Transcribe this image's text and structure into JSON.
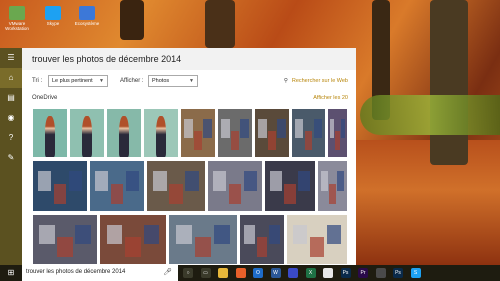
{
  "desktop": {
    "icons": [
      {
        "label": "VMware Workstation",
        "color": "#6aa84f"
      },
      {
        "label": "Skype",
        "color": "#1da1f2"
      },
      {
        "label": "Ecosystème",
        "color": "#3c78d8"
      }
    ]
  },
  "rail": {
    "items": [
      {
        "icon": "menu-icon",
        "glyph": "☰"
      },
      {
        "icon": "home-icon",
        "glyph": "⌂"
      },
      {
        "icon": "notebook-icon",
        "glyph": "▤"
      },
      {
        "icon": "location-icon",
        "glyph": "◉"
      },
      {
        "icon": "help-icon",
        "glyph": "?"
      },
      {
        "icon": "feedback-icon",
        "glyph": "✎"
      }
    ]
  },
  "panel": {
    "title": "trouver les photos de décembre 2014",
    "sort_label": "Tri :",
    "sort_value": "Le plus pertinent",
    "filter_label": "Afficher :",
    "filter_value": "Photos",
    "web_search": "Rechercher sur le Web",
    "source": "OneDrive",
    "show_all": "Afficher les 20"
  },
  "photos": [
    {
      "kind": "person",
      "bg": "#7db8a8"
    },
    {
      "kind": "person",
      "bg": "#8fc0b0"
    },
    {
      "kind": "person",
      "bg": "#86b9a9"
    },
    {
      "kind": "person",
      "bg": "#9cc7b8"
    },
    {
      "kind": "items",
      "bg": "#8b6b4a"
    },
    {
      "kind": "items",
      "bg": "#6b6b6b"
    },
    {
      "kind": "items",
      "bg": "#5a4a3a"
    },
    {
      "kind": "items",
      "bg": "#4a5a6a"
    },
    {
      "kind": "items",
      "bg": "#5c5070"
    },
    {
      "kind": "items",
      "bg": "#2e4a6a"
    },
    {
      "kind": "items",
      "bg": "#4a6a8a"
    },
    {
      "kind": "items",
      "bg": "#6a5a4a"
    },
    {
      "kind": "items",
      "bg": "#7a7a8a"
    },
    {
      "kind": "items",
      "bg": "#3a3a4a"
    },
    {
      "kind": "items",
      "bg": "#8a8a9a"
    },
    {
      "kind": "items",
      "bg": "#5a5a6a"
    },
    {
      "kind": "items",
      "bg": "#7a4a3a"
    },
    {
      "kind": "items",
      "bg": "#6a7a8a"
    },
    {
      "kind": "items",
      "bg": "#4a4a5a"
    },
    {
      "kind": "items",
      "bg": "#d8d0c0"
    },
    {
      "kind": "items",
      "bg": "#5a3a2a"
    }
  ],
  "taskbar": {
    "start_glyph": "⊞",
    "search_text": "trouver les photos de décembre 2014",
    "apps": [
      {
        "name": "cortana-icon",
        "color": "#3a3a2a",
        "glyph": "○"
      },
      {
        "name": "task-view-icon",
        "color": "#3a3a2a",
        "glyph": "▭"
      },
      {
        "name": "file-explorer-icon",
        "color": "#e8b83a",
        "glyph": ""
      },
      {
        "name": "firefox-icon",
        "color": "#e8602a",
        "glyph": ""
      },
      {
        "name": "outlook-icon",
        "color": "#1e6cc8",
        "glyph": "O"
      },
      {
        "name": "word-icon",
        "color": "#2b5797",
        "glyph": "W"
      },
      {
        "name": "firefox-2-icon",
        "color": "#3a4ac8",
        "glyph": ""
      },
      {
        "name": "excel-icon",
        "color": "#1e7145",
        "glyph": "X"
      },
      {
        "name": "store-icon",
        "color": "#e8e8e8",
        "glyph": ""
      },
      {
        "name": "photoshop-icon",
        "color": "#0a2a4a",
        "glyph": "Ps"
      },
      {
        "name": "premiere-icon",
        "color": "#2a0a4a",
        "glyph": "Pr"
      },
      {
        "name": "calculator-icon",
        "color": "#4a4a4a",
        "glyph": ""
      },
      {
        "name": "photoshop-2-icon",
        "color": "#0a2a4a",
        "glyph": "Ps"
      },
      {
        "name": "skype-icon",
        "color": "#1da1f2",
        "glyph": "S"
      }
    ]
  }
}
